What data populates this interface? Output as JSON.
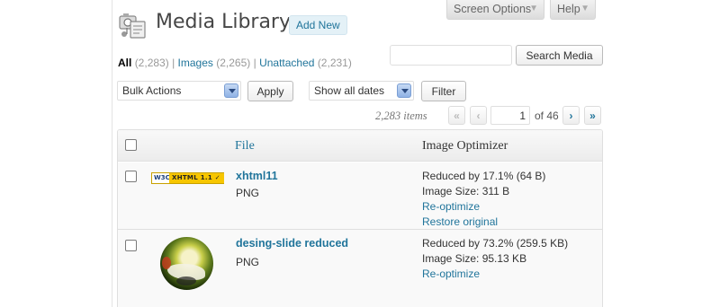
{
  "header": {
    "title": "Media Library",
    "add_new": "Add New",
    "screen_options": "Screen Options",
    "help": "Help",
    "caret": "▼"
  },
  "filters": {
    "all": {
      "label": "All",
      "count": "(2,283)"
    },
    "separator": "|",
    "images": {
      "label": "Images",
      "count": "(2,265)"
    },
    "unattached": {
      "label": "Unattached",
      "count": "(2,231)"
    }
  },
  "search": {
    "value": "",
    "button": "Search Media"
  },
  "bulk_actions": {
    "selected": "Bulk Actions",
    "apply": "Apply"
  },
  "date_filter": {
    "selected": "Show all dates",
    "filter": "Filter"
  },
  "pagination": {
    "items": "2,283 items",
    "first": "«",
    "prev": "‹",
    "current_page": "1",
    "of_text": "of 46",
    "next": "›",
    "last": "»"
  },
  "table": {
    "columns": {
      "file": "File",
      "optimizer": "Image Optimizer"
    },
    "rows": [
      {
        "thumb_text": {
          "w3c": "W3C",
          "badge": "XHTML 1.1 ✓"
        },
        "name": "xhtml11",
        "type": "PNG",
        "reduced": "Reduced by 17.1% (64 B)",
        "size": "Image Size: 311 B",
        "reoptimize": "Re-optimize",
        "restore": "Restore original"
      },
      {
        "name": "desing-slide reduced",
        "type": "PNG",
        "reduced": "Reduced by 73.2% (259.5 KB)",
        "size": "Image Size: 95.13 KB",
        "reoptimize": "Re-optimize"
      }
    ]
  },
  "colors": {
    "link": "#21759b",
    "title": "#464646",
    "header_bg": "#ececec"
  }
}
